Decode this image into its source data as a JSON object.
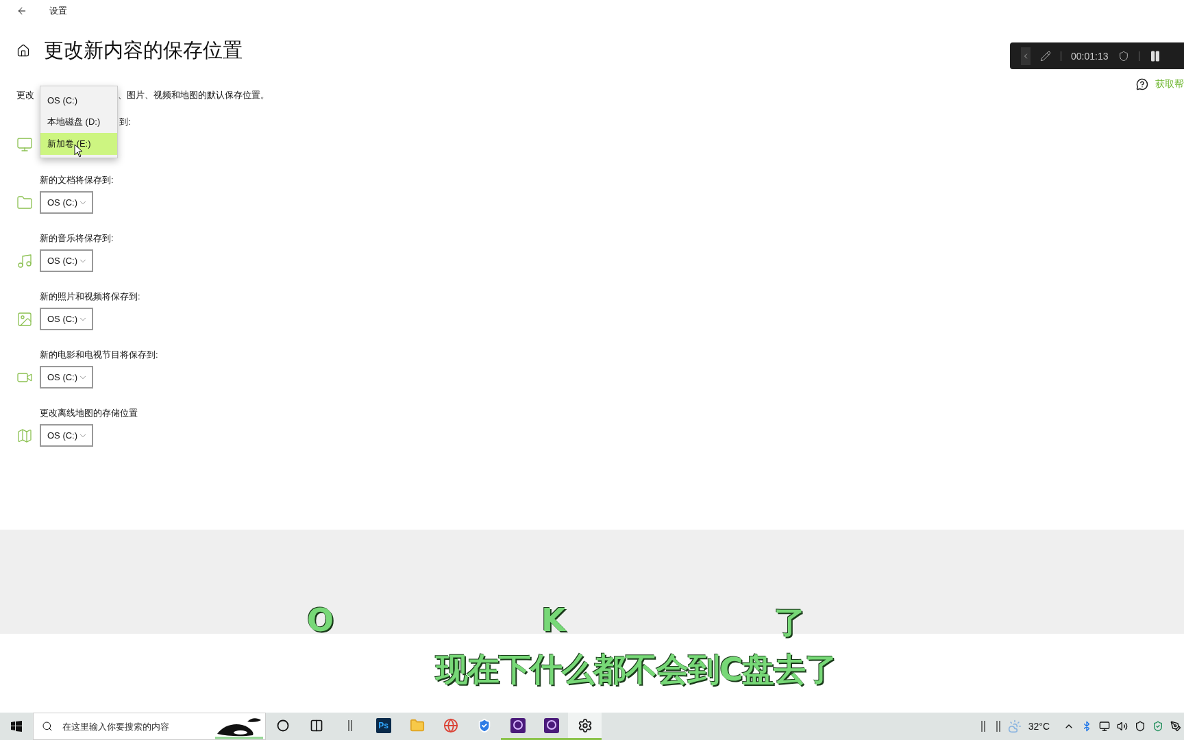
{
  "window": {
    "title": "设置"
  },
  "page": {
    "title": "更改新内容的保存位置",
    "description_parts": [
      "更改",
      "、图片、视频和地图的默认保存位置。"
    ],
    "help_link": "获取帮"
  },
  "locations": [
    {
      "kind": "apps",
      "label": "到:",
      "expanded": true,
      "options": [
        {
          "label": "OS (C:)",
          "selected": false
        },
        {
          "label": "本地磁盘 (D:)",
          "selected": false
        },
        {
          "label": "新加卷 (E:)",
          "selected": true
        }
      ]
    },
    {
      "kind": "documents",
      "label": "新的文档将保存到:",
      "expanded": false,
      "value": "OS (C:)"
    },
    {
      "kind": "music",
      "label": "新的音乐将保存到:",
      "expanded": false,
      "value": "OS (C:)"
    },
    {
      "kind": "photos",
      "label": "新的照片和视频将保存到:",
      "expanded": false,
      "value": "OS (C:)"
    },
    {
      "kind": "movies",
      "label": "新的电影和电视节目将保存到:",
      "expanded": false,
      "value": "OS (C:)"
    },
    {
      "kind": "maps",
      "label": "更改离线地图的存储位置",
      "expanded": false,
      "value": "OS (C:)"
    }
  ],
  "recorder": {
    "time": "00:01:13"
  },
  "captions": {
    "spaced": [
      "O",
      "K",
      "了"
    ],
    "line": "现在下什么都不会到C盘去了"
  },
  "taskbar": {
    "search_placeholder": "在这里输入你要搜索的内容",
    "apps": [
      {
        "kind": "cortana",
        "running": false,
        "selected": false
      },
      {
        "kind": "taskview",
        "running": false,
        "selected": false
      },
      {
        "kind": "divider",
        "running": false,
        "selected": false
      },
      {
        "kind": "photoshop",
        "label": "Ps",
        "running": false,
        "selected": false
      },
      {
        "kind": "folder",
        "running": false,
        "selected": false
      },
      {
        "kind": "browser",
        "running": false,
        "selected": false
      },
      {
        "kind": "shield",
        "running": false,
        "selected": false
      },
      {
        "kind": "recorder",
        "running": true,
        "selected": false
      },
      {
        "kind": "recorder",
        "running": true,
        "selected": false
      },
      {
        "kind": "settings",
        "running": true,
        "selected": true
      }
    ],
    "temperature": "32°C"
  }
}
